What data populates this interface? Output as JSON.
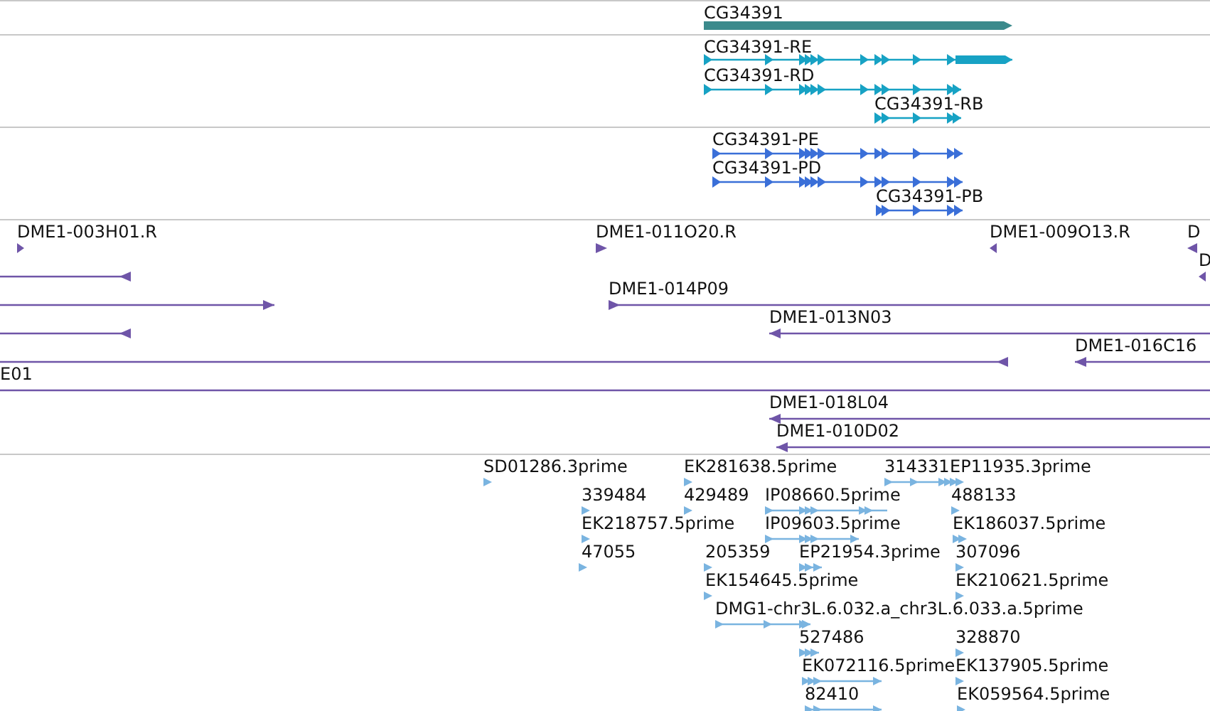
{
  "tracks": [
    {
      "kind": "gene",
      "color": "#3b8a8c",
      "features": [
        {
          "label": "CG34391",
          "reverse": false
        }
      ]
    },
    {
      "kind": "transcript",
      "color": "#17a2c4",
      "features": [
        {
          "label": "CG34391-RE",
          "reverse": false
        },
        {
          "label": "CG34391-RD",
          "reverse": false
        },
        {
          "label": "CG34391-RB",
          "reverse": false
        }
      ]
    },
    {
      "kind": "transcript",
      "color": "#3a6fd8",
      "features": [
        {
          "label": "CG34391-PE",
          "reverse": false
        },
        {
          "label": "CG34391-PD",
          "reverse": false
        },
        {
          "label": "CG34391-PB",
          "reverse": false
        }
      ]
    },
    {
      "kind": "clone",
      "color": "#6f55a8",
      "features": [
        {
          "label": "DME1-003H01.R",
          "reverse": false
        },
        {
          "label": "DME1-011O20.R",
          "reverse": false
        },
        {
          "label": "DME1-009O13.R",
          "reverse": true
        },
        {
          "label": "D",
          "reverse": true
        },
        {
          "label": "D",
          "reverse": true
        },
        {
          "reverse": true
        },
        {
          "reverse": false
        },
        {
          "label": "DME1-014P09",
          "reverse": false
        },
        {
          "reverse": true
        },
        {
          "label": "DME1-013N03",
          "reverse": true
        },
        {
          "reverse": true
        },
        {
          "label": "DME1-016C16",
          "reverse": true
        },
        {
          "label": "E01"
        },
        {
          "label": "DME1-018L04",
          "reverse": true
        },
        {
          "label": "DME1-010D02",
          "reverse": true
        }
      ]
    },
    {
      "kind": "est",
      "color": "#7ab4e0",
      "features": [
        {
          "label": "SD01286.3prime",
          "reverse": false
        },
        {
          "label": "EK281638.5prime",
          "reverse": false
        },
        {
          "label": "314331",
          "reverse": false
        },
        {
          "label": "EP11935.3prime",
          "reverse": false
        },
        {
          "label": "339484",
          "reverse": false
        },
        {
          "label": "429489",
          "reverse": false
        },
        {
          "label": "IP08660.5prime",
          "reverse": false
        },
        {
          "label": "488133",
          "reverse": false
        },
        {
          "label": "EK218757.5prime",
          "reverse": false
        },
        {
          "label": "IP09603.5prime",
          "reverse": false
        },
        {
          "label": "EK186037.5prime",
          "reverse": false
        },
        {
          "label": "47055",
          "reverse": false
        },
        {
          "label": "205359",
          "reverse": false
        },
        {
          "label": "EP21954.3prime",
          "reverse": false
        },
        {
          "label": "307096",
          "reverse": false
        },
        {
          "label": "EK154645.5prime",
          "reverse": false
        },
        {
          "label": "EK210621.5prime",
          "reverse": false
        },
        {
          "label": "DMG1-chr3L.6.032.a_chr3L.6.033.a.5prime",
          "reverse": false
        },
        {
          "label": "527486",
          "reverse": false
        },
        {
          "label": "328870",
          "reverse": false
        },
        {
          "label": "EK072116.5prime",
          "reverse": false
        },
        {
          "label": "EK137905.5prime",
          "reverse": false
        },
        {
          "label": "82410",
          "reverse": false
        },
        {
          "label": "EK059564.5prime",
          "reverse": false
        }
      ]
    }
  ]
}
